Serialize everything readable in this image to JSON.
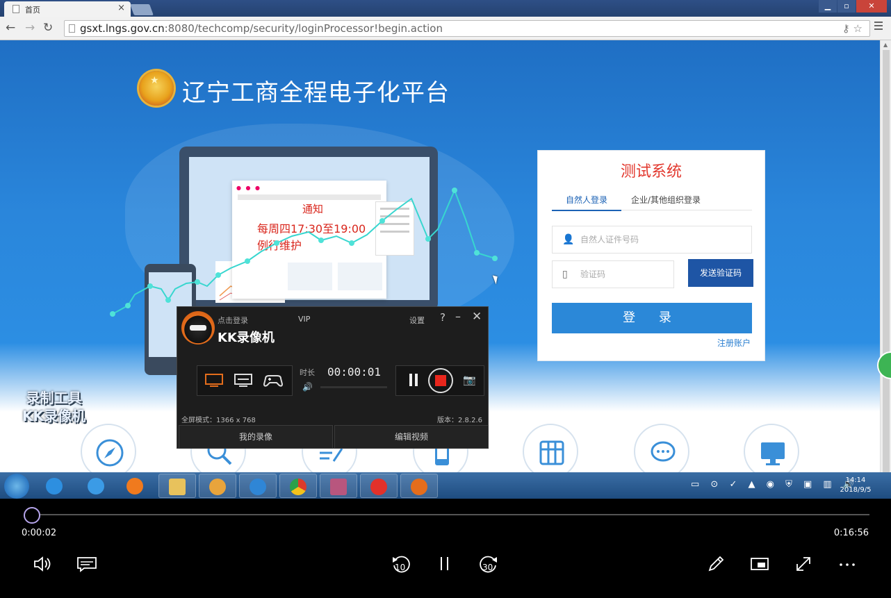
{
  "browser": {
    "tab_title": "首页",
    "url_domain": "gsxt.lngs.gov.cn",
    "url_path": ":8080/techcomp/security/loginProcessor!begin.action"
  },
  "site": {
    "title": "辽宁工商全程电子化平台",
    "notice": {
      "title": "通知",
      "line1": "每周四17:30至19:00",
      "line2": "例行维护"
    },
    "login": {
      "title": "测试系统",
      "tab_active": "自然人登录",
      "tab_other": "企业/其他组织登录",
      "id_placeholder": "自然人证件号码",
      "code_placeholder": "验证码",
      "send_code": "发送验证码",
      "submit": "登 录",
      "register": "注册账户"
    }
  },
  "watermark": {
    "line1": "录制工具",
    "line2": "KK录像机"
  },
  "recorder": {
    "login_label": "点击登录",
    "vip": "VIP",
    "name": "KK录像机",
    "settings": "设置",
    "help": "?",
    "minimize": "–",
    "close": "✕",
    "timer_label": "时长",
    "timer": "00:00:01",
    "mode_info": "全屏模式：1366 x 768",
    "version": "版本：2.8.2.6",
    "btn_my_videos": "我的录像",
    "btn_edit": "编辑视频"
  },
  "taskbar": {
    "time": "14:14",
    "date": "2018/9/5"
  },
  "player": {
    "current_time": "0:00:02",
    "total_time": "0:16:56",
    "progress": 0.002,
    "skip_back_label": "10",
    "skip_forward_label": "30"
  },
  "colors": {
    "accent": "#b7a6ec",
    "site_blue": "#2b88d8",
    "login_red": "#e2382e",
    "kk_orange": "#e46d1c"
  }
}
